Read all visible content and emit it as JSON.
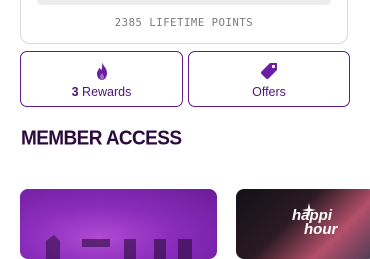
{
  "points": {
    "text": "2385 LIFETIME POINTS"
  },
  "tiles": {
    "rewards": {
      "count": "3",
      "label": "Rewards",
      "icon": "flame-icon"
    },
    "offers": {
      "label": "Offers",
      "icon": "tag-icon"
    }
  },
  "section": {
    "title": "MEMBER ACCESS"
  },
  "promos": {
    "second": {
      "line1": "happi",
      "line2": "hour"
    }
  },
  "colors": {
    "brand_purple": "#5e1c8f",
    "text_purple": "#4b1578",
    "heading": "#2b0a3d"
  }
}
